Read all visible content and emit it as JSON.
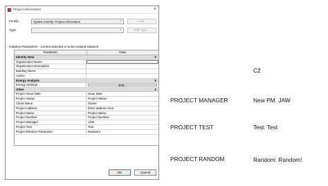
{
  "dialog": {
    "title": "Project Information",
    "close_glyph": "×",
    "family_label": "Family:",
    "family_value": "System Family: Project Information",
    "type_label": "Type:",
    "type_value": "",
    "load_button": "Load...",
    "edit_type_button": "Edit Type...",
    "section_caption": "Instance Parameters - Control selected or to-be-created instance",
    "grid": {
      "columns": [
        "Parameter",
        "Value"
      ],
      "groups": [
        {
          "name": "Identity Data",
          "toggle": "¥",
          "rows": [
            {
              "param": "Organization Name",
              "value": ""
            },
            {
              "param": "Organization Description",
              "value": ""
            },
            {
              "param": "Building Name",
              "value": ""
            },
            {
              "param": "Author",
              "value": ""
            }
          ]
        },
        {
          "name": "Energy Analysis",
          "toggle": "¥",
          "rows": [
            {
              "param": "Energy Settings",
              "value": "Edit..."
            }
          ]
        },
        {
          "name": "Other",
          "toggle": "¥",
          "rows": [
            {
              "param": "Project Issue Date",
              "value": "Issue Date"
            },
            {
              "param": "Project Status",
              "value": "Project Status"
            },
            {
              "param": "Client Name",
              "value": "Owner"
            },
            {
              "param": "Project Address",
              "value": "Enter address here"
            },
            {
              "param": "Project Name",
              "value": "Project Name"
            },
            {
              "param": "Project Number",
              "value": "Project Number"
            },
            {
              "param": "Project Manager",
              "value": "JAW"
            },
            {
              "param": "Project Test",
              "value": "Test"
            },
            {
              "param": "Project Random Parameter",
              "value": "Random!"
            }
          ]
        }
      ]
    },
    "ok_button": "OK",
    "cancel_button": "Cancel"
  },
  "annotations": {
    "c2": "C2",
    "pm_label": "PROJECT MANAGER",
    "pm_value": "New PM: JAW",
    "test_label": "PROJECT TEST",
    "test_value": "Test: Test",
    "random_label": "PROJECT RANDOM",
    "random_value": "Random: Random!"
  }
}
